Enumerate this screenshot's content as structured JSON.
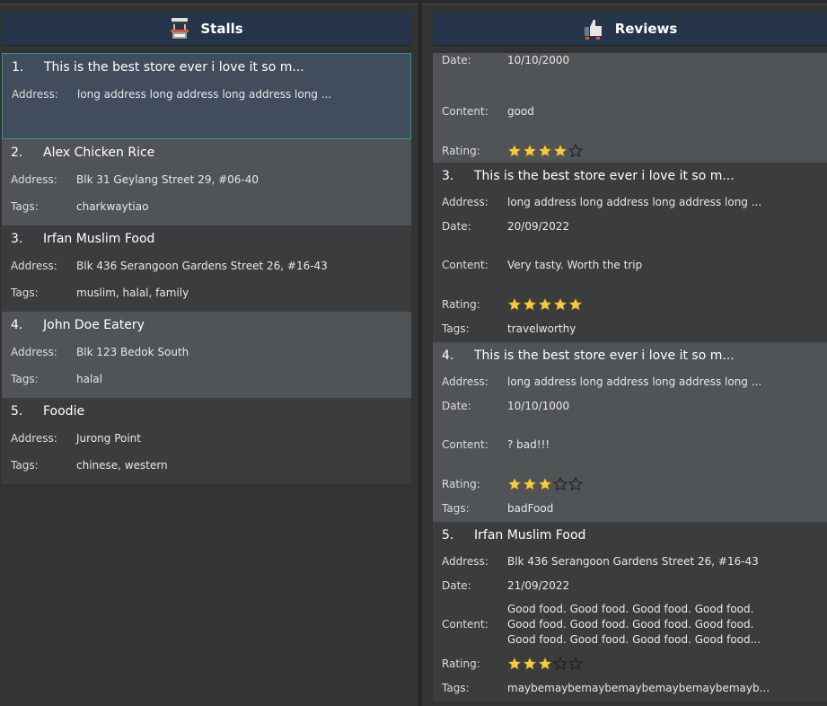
{
  "stalls": {
    "title": "Stalls",
    "icon": "food-stall-icon",
    "address_label": "Address:",
    "tags_label": "Tags:",
    "items": [
      {
        "index": "1.",
        "name": "This is the best store ever i love it so m...",
        "address": "long address long address long address long ...",
        "tags": ""
      },
      {
        "index": "2.",
        "name": "Alex Chicken Rice",
        "address": "Blk 31 Geylang Street 29, #06-40",
        "tags": "charkwaytiao"
      },
      {
        "index": "3.",
        "name": "Irfan Muslim Food",
        "address": "Blk 436 Serangoon Gardens Street 26, #16-43",
        "tags": "muslim, halal, family"
      },
      {
        "index": "4.",
        "name": "John Doe Eatery",
        "address": "Blk 123 Bedok South",
        "tags": "halal"
      },
      {
        "index": "5.",
        "name": "Foodie",
        "address": "Jurong Point",
        "tags": "chinese, western"
      }
    ]
  },
  "reviews": {
    "title": "Reviews",
    "icon": "thumbs-up-icon",
    "labels": {
      "address": "Address:",
      "date": "Date:",
      "content": "Content:",
      "rating": "Rating:",
      "tags": "Tags:"
    },
    "partial": {
      "date": "10/10/2000",
      "content": "good",
      "rating": 4
    },
    "items": [
      {
        "index": "3.",
        "name": "This is the best store ever i love it so m...",
        "address": "long address long address long address long ...",
        "date": "20/09/2022",
        "content": "Very tasty. Worth the trip",
        "rating": 5,
        "tags": "travelworthy"
      },
      {
        "index": "4.",
        "name": "This is the best store ever i love it so m...",
        "address": "long address long address long address long ...",
        "date": "10/10/1000",
        "content": "? bad!!!",
        "rating": 3,
        "tags": "badFood"
      },
      {
        "index": "5.",
        "name": "Irfan Muslim Food",
        "address": "Blk 436 Serangoon Gardens Street 26, #16-43",
        "date": "21/09/2022",
        "content_lines": [
          "Good food. Good food. Good food. Good food.",
          "Good food. Good food. Good food. Good food.",
          "Good food. Good food. Good food. Good food..."
        ],
        "rating": 3,
        "tags": "maybemaybemaybemaybemaybemaybemayb..."
      }
    ]
  },
  "colors": {
    "star_fill": "#f2c94c",
    "header_bg": "#253448",
    "selected_border": "#3f8d8d"
  }
}
